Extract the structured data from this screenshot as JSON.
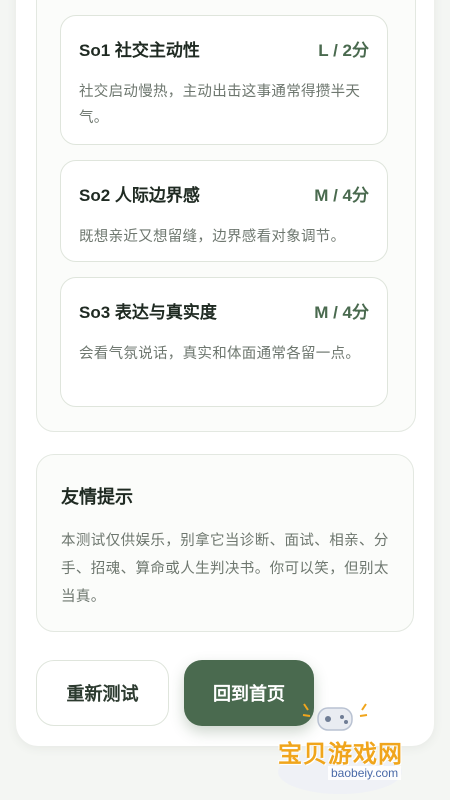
{
  "dimensions": [
    {
      "title": "So1 社交主动性",
      "score": "L / 2分",
      "desc": "社交启动慢热，主动出击这事通常得攒半天气。"
    },
    {
      "title": "So2 人际边界感",
      "score": "M / 4分",
      "desc": "既想亲近又想留缝，边界感看对象调节。"
    },
    {
      "title": "So3 表达与真实度",
      "score": "M / 4分",
      "desc": "会看气氛说话，真实和体面通常各留一点。"
    }
  ],
  "tip": {
    "title": "友情提示",
    "body": "本测试仅供娱乐，别拿它当诊断、面试、相亲、分手、招魂、算命或人生判决书。你可以笑，但别太当真。"
  },
  "buttons": {
    "retest": "重新测试",
    "home": "回到首页"
  },
  "watermark": {
    "text": "宝贝游戏网",
    "url": "baobeiy.com"
  },
  "colors": {
    "accent": "#4a6a4f",
    "muted_text": "#6e776f",
    "watermark": "#f0a51c"
  }
}
